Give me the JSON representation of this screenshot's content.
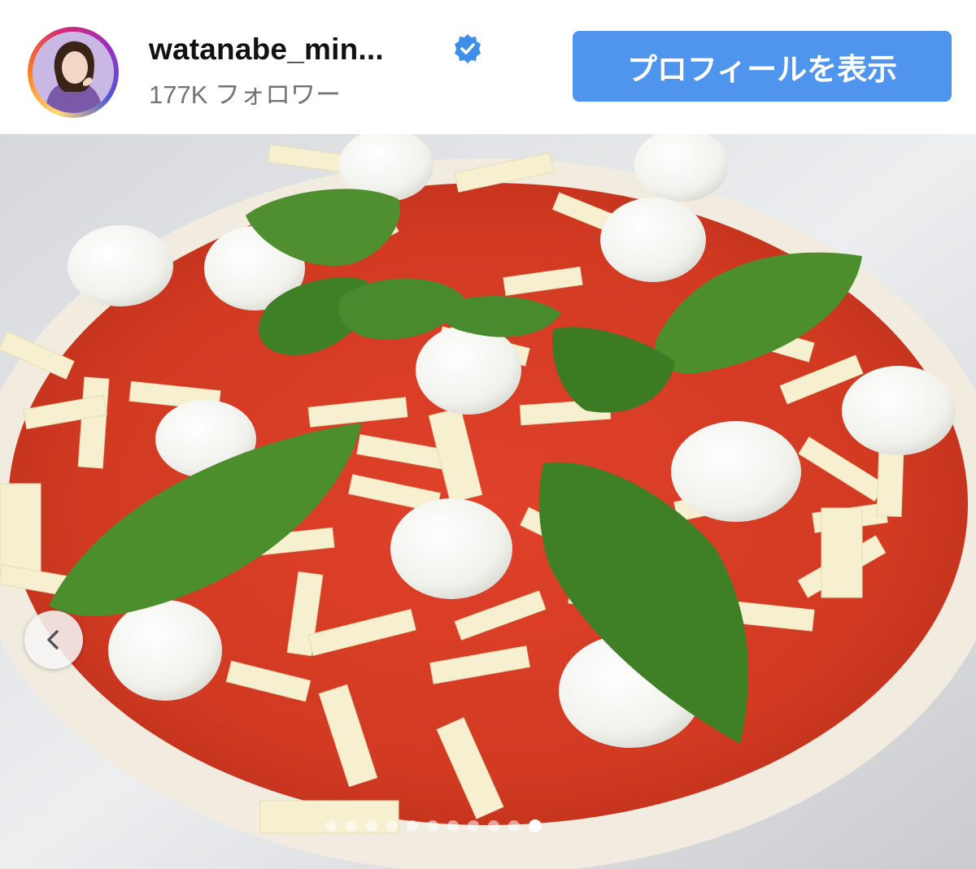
{
  "account": {
    "username": "watanabe_min...",
    "verified": true,
    "followers_text": "177K フォロワー"
  },
  "header": {
    "profile_button_label": "プロフィールを表示",
    "button_color": "#4f95ee",
    "verified_badge_color": "#3f8fe8"
  },
  "icons": {
    "verified": "verified-badge-icon",
    "prev": "chevron-left-icon"
  },
  "carousel": {
    "total_slides": 11,
    "current_slide": 11
  }
}
